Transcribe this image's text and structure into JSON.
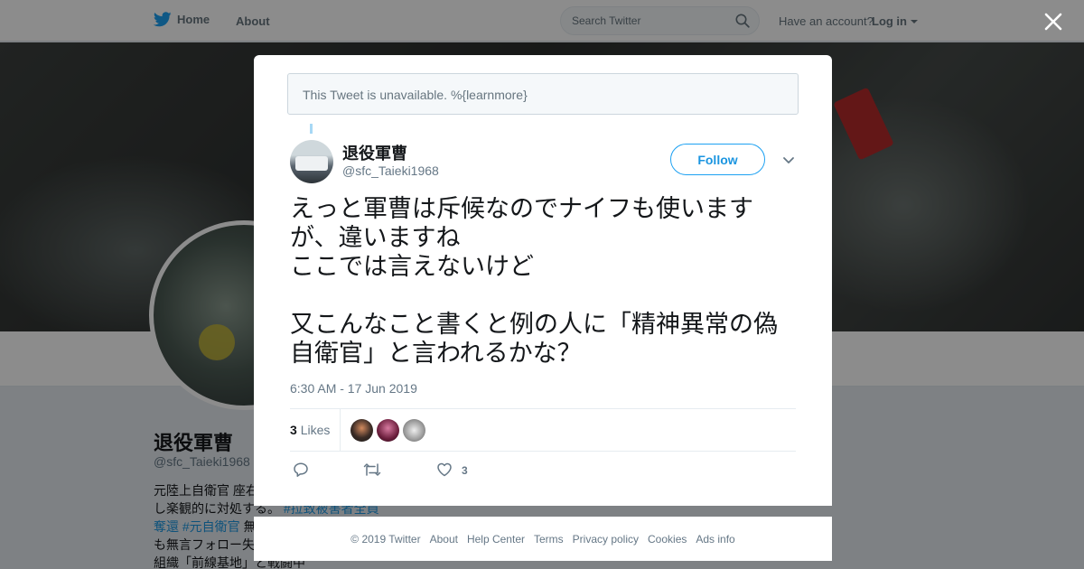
{
  "topbar": {
    "home_label": "Home",
    "about_label": "About",
    "search_placeholder": "Search Twitter",
    "account_prompt": "Have an account?",
    "login_label": "Log in"
  },
  "profile": {
    "name": "退役軍曹",
    "handle": "@sfc_Taieki1968",
    "bio_lines": [
      "元陸上自衛官 座右",
      "し楽観的に対処する。",
      "#拉致被害者全員",
      "奪還",
      "#元自衛官",
      "無",
      "も無言フォロー失",
      "組織「前線基地」と戦闘中"
    ]
  },
  "modal": {
    "notice": "This Tweet is unavailable. %{learnmore}",
    "author_name": "退役軍曹",
    "author_handle": "@sfc_Taieki1968",
    "follow_label": "Follow",
    "tweet_text": "えっと軍曹は斥候なのでナイフも使います\nが、違いますね\nここでは言えないけど\n\n又こんなこと書くと例の人に「精神異常の偽\n自衛官」と言われるかな？",
    "timestamp": "6:30 AM - 17 Jun 2019",
    "likes_number": "3",
    "likes_label": "Likes",
    "like_action_count": "3"
  },
  "footer": {
    "copyright": "© 2019 Twitter",
    "links": [
      "About",
      "Help Center",
      "Terms",
      "Privacy policy",
      "Cookies",
      "Ads info"
    ]
  },
  "colors": {
    "brand_blue": "#1da1f2",
    "link_blue": "#1b95e0",
    "muted_text": "#657786",
    "overlay": "rgba(0,0,0,0.45)"
  },
  "icons": [
    "twitter-bird-icon",
    "search-icon",
    "close-icon",
    "chevron-down-icon",
    "reply-icon",
    "retweet-icon",
    "heart-icon"
  ]
}
